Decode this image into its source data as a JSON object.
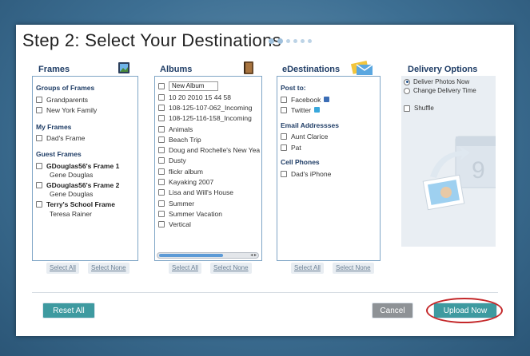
{
  "title": "Step 2: Select Your Destinations",
  "frames": {
    "header": "Frames",
    "groups_heading": "Groups of Frames",
    "groups": [
      "Grandparents",
      "New York Family"
    ],
    "my_heading": "My Frames",
    "my_frames": [
      "Dad's Frame"
    ],
    "guest_heading": "Guest Frames",
    "guest_frames": [
      {
        "name": "GDouglas56's Frame 1",
        "owner": "Gene Douglas"
      },
      {
        "name": "GDouglas56's Frame 2",
        "owner": "Gene Douglas"
      },
      {
        "name": "Terry's School Frame",
        "owner": "Teresa Rainer"
      }
    ],
    "select_all": "Select All",
    "select_none": "Select None"
  },
  "albums": {
    "header": "Albums",
    "new_album_value": "New Album",
    "items": [
      "10 20 2010 15 44 58",
      "108-125-107-062_Incoming",
      "108-125-116-158_Incoming",
      "Animals",
      "Beach Trip",
      "Doug and Rochelle's New Yea",
      "Dusty",
      "flickr album",
      "Kayaking 2007",
      "Lisa and Will's House",
      "Summer",
      "Summer Vacation",
      "Vertical"
    ],
    "select_all": "Select All",
    "select_none": "Select None"
  },
  "edest": {
    "header": "eDestinations",
    "post_heading": "Post to:",
    "post": [
      "Facebook",
      "Twitter"
    ],
    "email_heading": "Email Addressses",
    "emails": [
      "Aunt Clarice",
      "Pat"
    ],
    "phones_heading": "Cell Phones",
    "phones": [
      "Dad's iPhone"
    ],
    "select_all": "Select All",
    "select_none": "Select None"
  },
  "delivery": {
    "header": "Delivery Options",
    "deliver_now": "Deliver Photos Now",
    "change_time": "Change Delivery Time",
    "shuffle": "Shuffle"
  },
  "buttons": {
    "reset": "Reset All",
    "cancel": "Cancel",
    "upload": "Upload Now"
  },
  "colors": {
    "teal_button": "#3e9aa0",
    "gray_button": "#8e9296",
    "highlight": "#c4282a"
  }
}
